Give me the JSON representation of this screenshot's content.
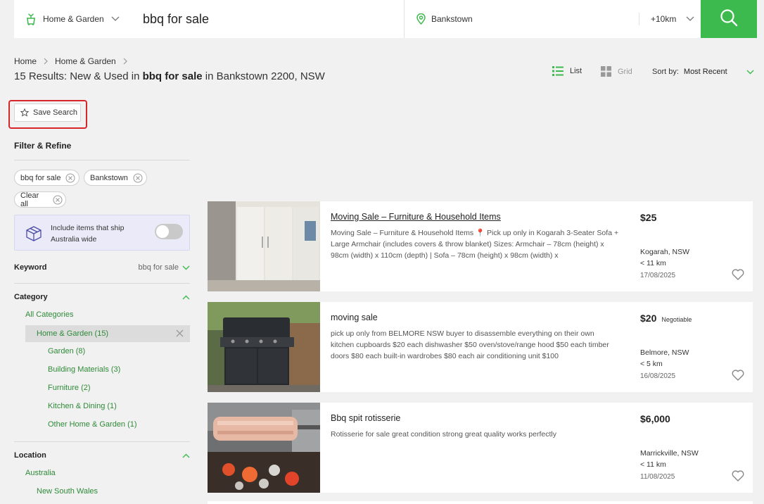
{
  "header": {
    "category": "Home & Garden",
    "query": "bbq for sale",
    "location": "Bankstown",
    "radius": "+10km"
  },
  "breadcrumb": [
    "Home",
    "Home & Garden"
  ],
  "results": {
    "prefix": "15 Results: New & Used in ",
    "query": "bbq for sale",
    "suffix": " in Bankstown 2200, NSW"
  },
  "view": {
    "list": "List",
    "grid": "Grid"
  },
  "sort": {
    "label": "Sort by:",
    "value": "Most Recent"
  },
  "save_search": "Save Search",
  "filter": {
    "title": "Filter & Refine",
    "chips": [
      "bbq for sale",
      "Bankstown",
      "Clear all"
    ],
    "ship": {
      "text": "Include items that ship Australia wide",
      "enabled": false
    }
  },
  "keyword": {
    "label": "Keyword",
    "value": "bbq for sale"
  },
  "category": {
    "label": "Category",
    "all": "All Categories",
    "selected": "Home & Garden (15)",
    "subs": [
      "Garden (8)",
      "Building Materials (3)",
      "Furniture (2)",
      "Kitchen & Dining (1)",
      "Other Home & Garden (1)"
    ]
  },
  "location": {
    "label": "Location",
    "items": [
      "Australia",
      "New South Wales"
    ]
  },
  "listings": [
    {
      "title": "Moving Sale – Furniture & Household Items",
      "desc": "Moving Sale – Furniture & Household Items 📍 Pick up only in Kogarah 3-Seater Sofa + Large Armchair (includes covers & throw blanket) Sizes: Armchair – 78cm (height) x 98cm (width) x 110cm (depth) | Sofa – 78cm (height) x 98cm (width) x",
      "price": "$25",
      "negotiable": "",
      "suburb": "Kogarah, NSW",
      "distance": "< 11 km",
      "date": "17/08/2025"
    },
    {
      "title": "moving sale",
      "desc": "pick up only from BELMORE NSW buyer to disassemble everything on their own kitchen cupboards $20 each dishwasher $50 oven/stove/range hood $50 each timber doors $80 each built-in wardrobes $80 each air conditioning unit $100",
      "price": "$20",
      "negotiable": "Negotiable",
      "suburb": "Belmore, NSW",
      "distance": "< 5 km",
      "date": "16/08/2025"
    },
    {
      "title": "Bbq spit rotisserie",
      "desc": "Rotisserie for sale great condition strong great quality works perfectly",
      "price": "$6,000",
      "negotiable": "",
      "suburb": "Marrickville, NSW",
      "distance": "< 11 km",
      "date": "11/08/2025"
    }
  ],
  "colors": {
    "accent": "#3dba4e",
    "link": "#2e8a38",
    "annotation": "#d8252a"
  }
}
